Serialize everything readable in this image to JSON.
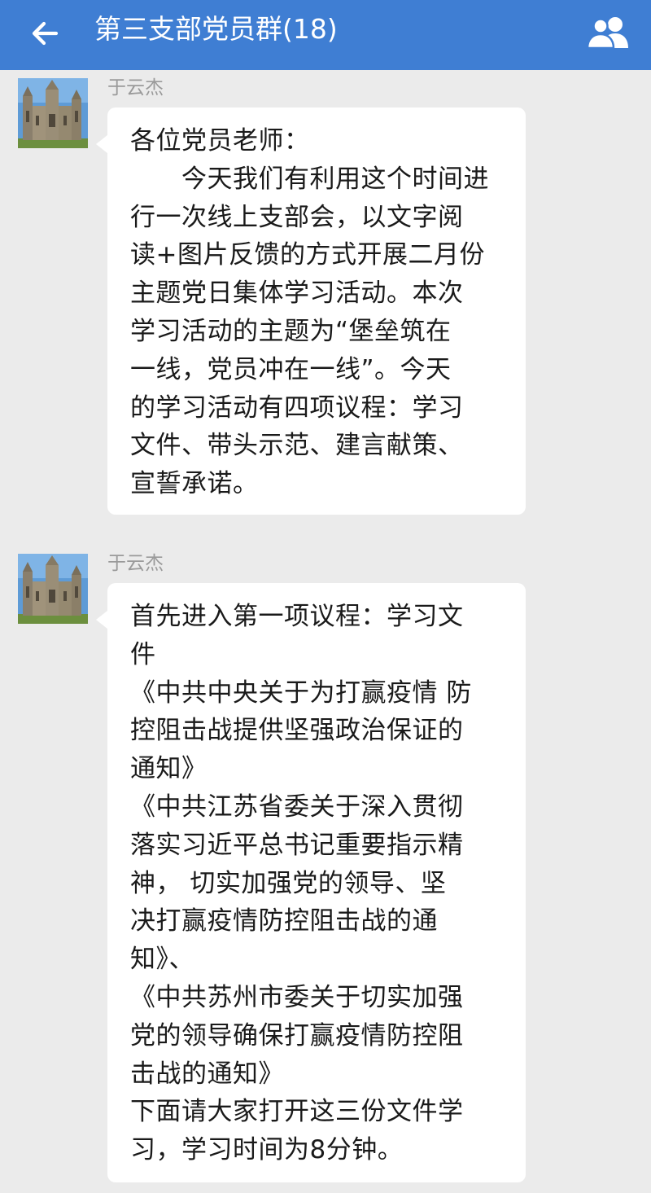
{
  "header": {
    "title": "第三支部党员群(18)",
    "back_icon": "arrow-left-icon",
    "members_icon": "group-members-icon",
    "background": "#3f7ed3"
  },
  "messages": [
    {
      "sender": "于云杰",
      "avatar": "cathedral-avatar",
      "lines": [
        "各位党员老师：",
        "　　今天我们有利用这个时间进",
        "行一次线上支部会，以文字阅",
        "读+图片反馈的方式开展二月份",
        "主题党日集体学习活动。本次",
        "学习活动的主题为“堡垒筑在",
        "一线，党员冲在一线”。今天",
        "的学习活动有四项议程：学习",
        "文件、带头示范、建言献策、",
        "宣誓承诺。"
      ]
    },
    {
      "sender": "于云杰",
      "avatar": "cathedral-avatar",
      "lines": [
        "首先进入第一项议程：学习文",
        "件",
        "《中共中央关于为打赢疫情 防",
        "控阻击战提供坚强政治保证的",
        "通知》",
        "《中共江苏省委关于深入贯彻",
        "落实习近平总书记重要指示精",
        "神， 切实加强党的领导、坚",
        "决打赢疫情防控阻击战的通",
        "知》、",
        "《中共苏州市委关于切实加强",
        "党的领导确保打赢疫情防控阻",
        "击战的通知》",
        "下面请大家打开这三份文件学",
        "习，学习时间为8分钟。"
      ]
    }
  ]
}
